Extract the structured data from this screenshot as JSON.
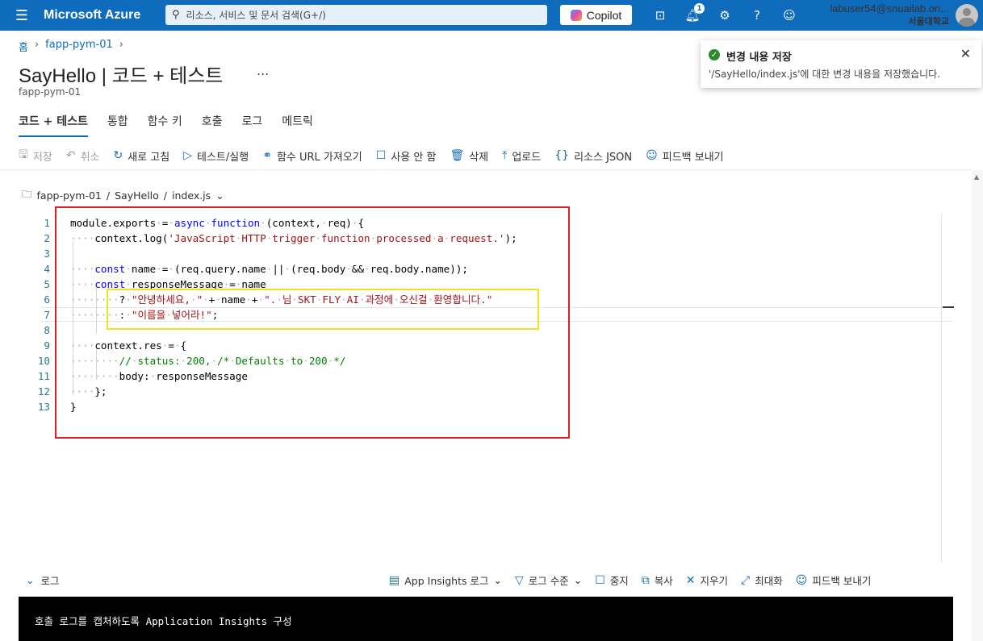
{
  "topbar": {
    "brand": "Microsoft Azure",
    "search_placeholder": "리소스, 서비스 및 문서 검색(G+/)",
    "copilot": "Copilot",
    "notification_count": "1",
    "user_name": "labuser54@snuailab.on...",
    "user_org": "서울대학교"
  },
  "breadcrumb": {
    "home": "홈",
    "resource": "fapp-pym-01"
  },
  "page": {
    "title": "SayHello | 코드 + 테스트",
    "more": "...",
    "subtitle": "fapp-pym-01"
  },
  "tabs": [
    "코드 + 테스트",
    "통합",
    "함수 키",
    "호출",
    "로그",
    "메트릭"
  ],
  "toolbar": [
    {
      "icon": "save-icon",
      "label": "저장"
    },
    {
      "icon": "undo-icon",
      "label": "취소"
    },
    {
      "icon": "refresh-icon",
      "label": "새로 고침"
    },
    {
      "icon": "play-icon",
      "label": "테스트/실행"
    },
    {
      "icon": "link-icon",
      "label": "함수 URL 가져오기"
    },
    {
      "icon": "checkbox-icon",
      "label": "사용 안 함"
    },
    {
      "icon": "trash-icon",
      "label": "삭제"
    },
    {
      "icon": "upload-icon",
      "label": "업로드"
    },
    {
      "icon": "braces-icon",
      "label": "리소스 JSON"
    },
    {
      "icon": "feedback-icon",
      "label": "피드백 보내기"
    }
  ],
  "filepath": {
    "app": "fapp-pym-01",
    "function": "SayHello",
    "file": "index.js"
  },
  "code_lines": [
    "module.exports = async function (context, req) {",
    "    context.log('JavaScript HTTP trigger function processed a request.');",
    "",
    "    const name = (req.query.name || (req.body && req.body.name));",
    "    const responseMessage = name",
    "        ? \"안녕하세요, \" + name + \". 님 SKT FLY AI 과정에 오신걸 환영합니다.\"",
    "        : \"이름을 넣어라!\";",
    "",
    "    context.res = {",
    "        // status: 200, /* Defaults to 200 */",
    "        body: responseMessage",
    "    };",
    "}"
  ],
  "logs": {
    "title": "로그",
    "tools": [
      {
        "icon": "document-icon",
        "label": "App Insights 로그"
      },
      {
        "icon": "filter-icon",
        "label": "로그 수준"
      },
      {
        "icon": "stop-icon",
        "label": "중지"
      },
      {
        "icon": "copy-icon",
        "label": "복사"
      },
      {
        "icon": "clear-icon",
        "label": "지우기"
      },
      {
        "icon": "maximize-icon",
        "label": "최대화"
      },
      {
        "icon": "feedback-icon",
        "label": "피드백 보내기"
      }
    ],
    "console_text": "호출 로그를 캡처하도록 Application Insights 구성"
  },
  "toast": {
    "title": "변경 내용 저장",
    "message": "'/SayHello/index.js'에 대한 변경 내용을 저장했습니다."
  }
}
